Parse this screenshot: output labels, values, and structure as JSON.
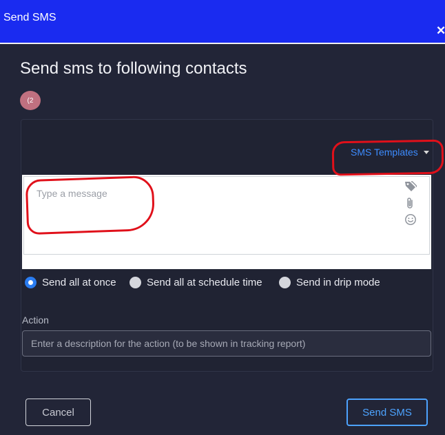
{
  "window": {
    "title": "Send SMS",
    "close_glyph": "✕"
  },
  "heading": "Send sms to following contacts",
  "contacts": [
    {
      "initials": "(2"
    }
  ],
  "templates": {
    "label": "SMS Templates"
  },
  "message": {
    "placeholder": "Type a message",
    "value": ""
  },
  "message_tools": [
    "tag-icon",
    "attachment-icon",
    "emoji-icon"
  ],
  "send_modes": [
    {
      "label": "Send all at once",
      "checked": true
    },
    {
      "label": "Send all at schedule time",
      "checked": false
    },
    {
      "label": "Send in drip mode",
      "checked": false
    }
  ],
  "action": {
    "label": "Action",
    "placeholder": "Enter a description for the action (to be shown in tracking report)",
    "value": ""
  },
  "buttons": {
    "cancel": "Cancel",
    "send": "Send SMS"
  },
  "colors": {
    "header": "#1a2bf0",
    "background": "#222537",
    "accent": "#3d8cff",
    "annotation": "#e0101a"
  }
}
